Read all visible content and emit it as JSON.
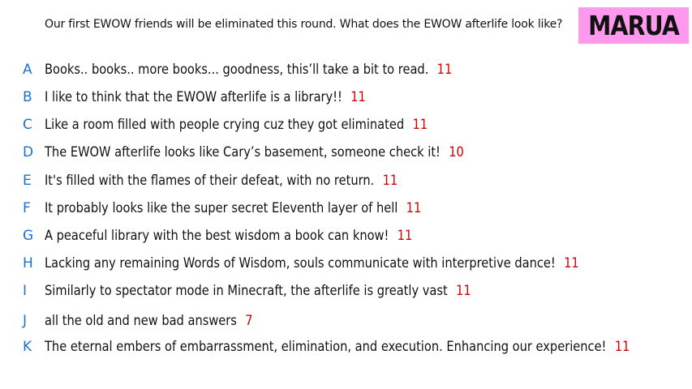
{
  "prompt": "Our first EWOW friends will be eliminated this round. What does the EWOW afterlife look like?",
  "contestant": "MARUA",
  "colors": {
    "name_box_bg": "#ff99ee",
    "letter": "#1f6fd1",
    "score": "#d40000"
  },
  "responses": [
    {
      "letter": "A",
      "text": "Books.. books.. more books... goodness, this’ll take a bit to read.",
      "score": "11"
    },
    {
      "letter": "B",
      "text": "I like to think that the EWOW afterlife is a library!!",
      "score": "11"
    },
    {
      "letter": "C",
      "text": "Like a room filled with people crying cuz they got eliminated",
      "score": "11"
    },
    {
      "letter": "D",
      "text": "The EWOW afterlife looks like Cary’s basement, someone check it!",
      "score": "10"
    },
    {
      "letter": "E",
      "text": "It's filled with the flames of their defeat, with no return.",
      "score": "11"
    },
    {
      "letter": "F",
      "text": "It probably looks like the super secret Eleventh layer of hell",
      "score": "11"
    },
    {
      "letter": "G",
      "text": "A peaceful library with the best wisdom a book can know!",
      "score": "11"
    },
    {
      "letter": "H",
      "text": "Lacking any remaining Words of Wisdom, souls communicate with interpretive dance!",
      "score": "11"
    },
    {
      "letter": "I",
      "text": "Similarly to spectator mode in Minecraft, the afterlife is greatly vast",
      "score": "11"
    },
    {
      "letter": "J",
      "text": "all the old and new bad answers",
      "score": "7"
    },
    {
      "letter": "K",
      "text": "The eternal embers of embarrassment, elimination, and execution. Enhancing our experience!",
      "score": "11"
    }
  ]
}
